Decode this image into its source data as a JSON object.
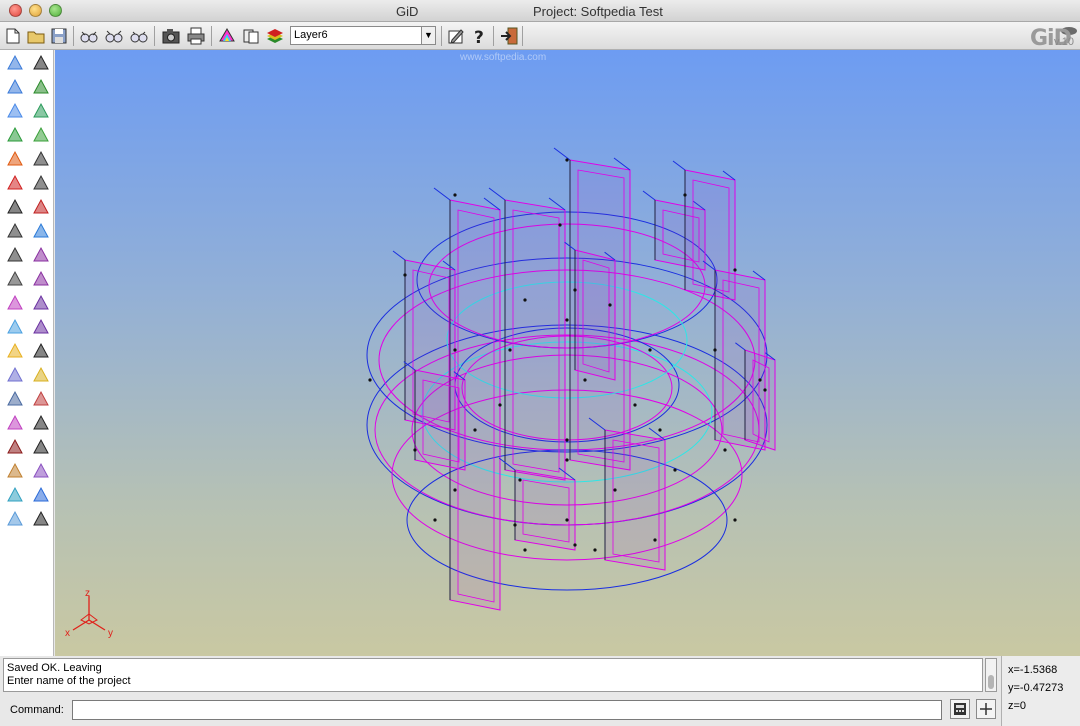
{
  "window": {
    "app_title": "GiD",
    "project_title": "Project: Softpedia Test"
  },
  "toolbar": {
    "layer_value": "Layer6",
    "buttons": [
      "new-file-icon",
      "open-folder-icon",
      "save-icon",
      "zoom-glasses-icon",
      "zoom-glasses-in-icon",
      "zoom-glasses-out-icon",
      "camera-icon",
      "print-icon",
      "render-palette-icon",
      "layers-copy-icon",
      "layers-icon",
      "dropdown-arrow-icon",
      "edit-pen-icon",
      "help-icon",
      "exit-icon"
    ]
  },
  "logo": {
    "text": "GiD",
    "version": "v.10"
  },
  "watermark": "www.softpedia.com",
  "palette_icons": [
    "zoom-in-icon",
    "zoom-out-icon",
    "zoom-fit-icon",
    "recycle-icon",
    "render-sphere-icon",
    "arrow-icon",
    "line-icon",
    "arc-icon",
    "nurbs-icon",
    "polyline-icon",
    "surface-icon",
    "box-volume-icon",
    "prism-icon",
    "erase-icon",
    "collapse-icon",
    "mesh-icon",
    "dot-icon",
    "pencil-icon",
    "eraser-icon",
    "rectangle-icon",
    "list-e-icon",
    "surface-mesh-icon",
    "green-mesh-icon",
    "green-surface-icon",
    "bezier-icon",
    "curve-node-icon",
    "curve-split-icon",
    "scissors-icon",
    "grid-icon",
    "quad-mesh-icon",
    "triangle-mesh-icon",
    "structured-mesh-icon",
    "numbering-icon",
    "condition-icon",
    "measure-icon",
    "distance-icon",
    "xy-coords-icon",
    "rotate-icon",
    "info-icon",
    "dimension-icon"
  ],
  "axes": {
    "x": "x",
    "y": "y",
    "z": "z"
  },
  "messages": {
    "line1": "Saved OK. Leaving",
    "line2": "Enter name of the project"
  },
  "coords": {
    "x": "x=-1.5368",
    "y": "y=-0.47273",
    "z": "z=0"
  },
  "command": {
    "label": "Command:",
    "value": ""
  },
  "colors": {
    "blue_edges": "#1a2ee0",
    "magenta_edges": "#e000e8",
    "cyan_edges": "#2ee6e6",
    "axes": "#e0201a"
  }
}
